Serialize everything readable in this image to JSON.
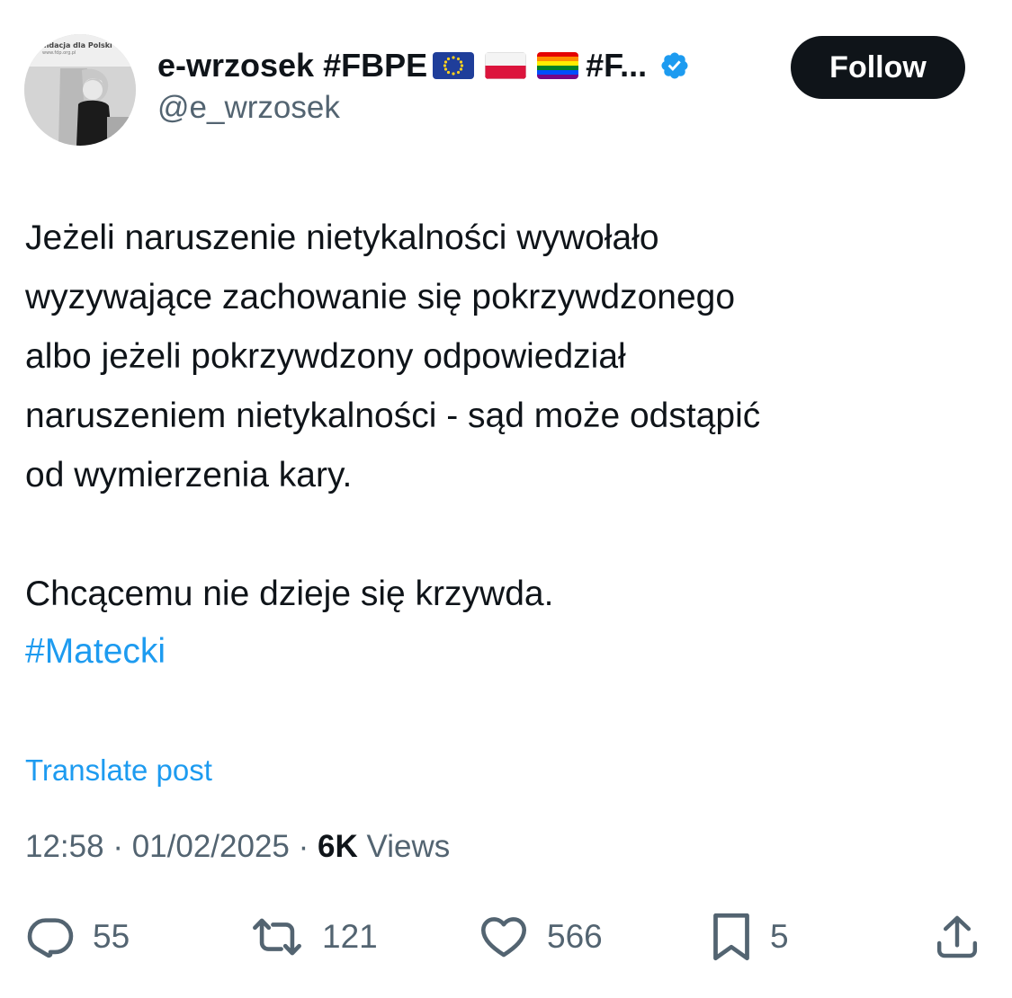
{
  "author": {
    "display_name": "e-wrzosek #FBPE",
    "name_tail": "#F...",
    "handle": "@e_wrzosek",
    "flags": [
      "eu-flag-icon",
      "poland-flag-icon",
      "rainbow-flag-icon"
    ],
    "verified": true,
    "avatar": {
      "banner_text": "undacja dla Polski",
      "banner_sub": "www.fdp.org.pl"
    }
  },
  "follow_label": "Follow",
  "tweet": {
    "lines": [
      "Jeżeli naruszenie nietykalności wywołało",
      "wyzywające zachowanie się pokrzywdzonego",
      "albo jeżeli pokrzywdzony odpowiedział",
      "naruszeniem nietykalności - sąd może odstąpić",
      "od wymierzenia kary.",
      "",
      "Chcącemu nie dzieje się krzywda."
    ],
    "hashtag": "#Matecki"
  },
  "translate_label": "Translate post",
  "meta": {
    "time": "12:58",
    "separator": "·",
    "date": "01/02/2025",
    "views_count": "6K",
    "views_label": "Views"
  },
  "actions": {
    "replies": "55",
    "reposts": "121",
    "likes": "566",
    "bookmarks": "5"
  },
  "colors": {
    "text": "#0f1419",
    "secondary": "#536471",
    "link": "#1d9bf0",
    "verified": "#1d9bf0",
    "button_bg": "#0f1419"
  }
}
